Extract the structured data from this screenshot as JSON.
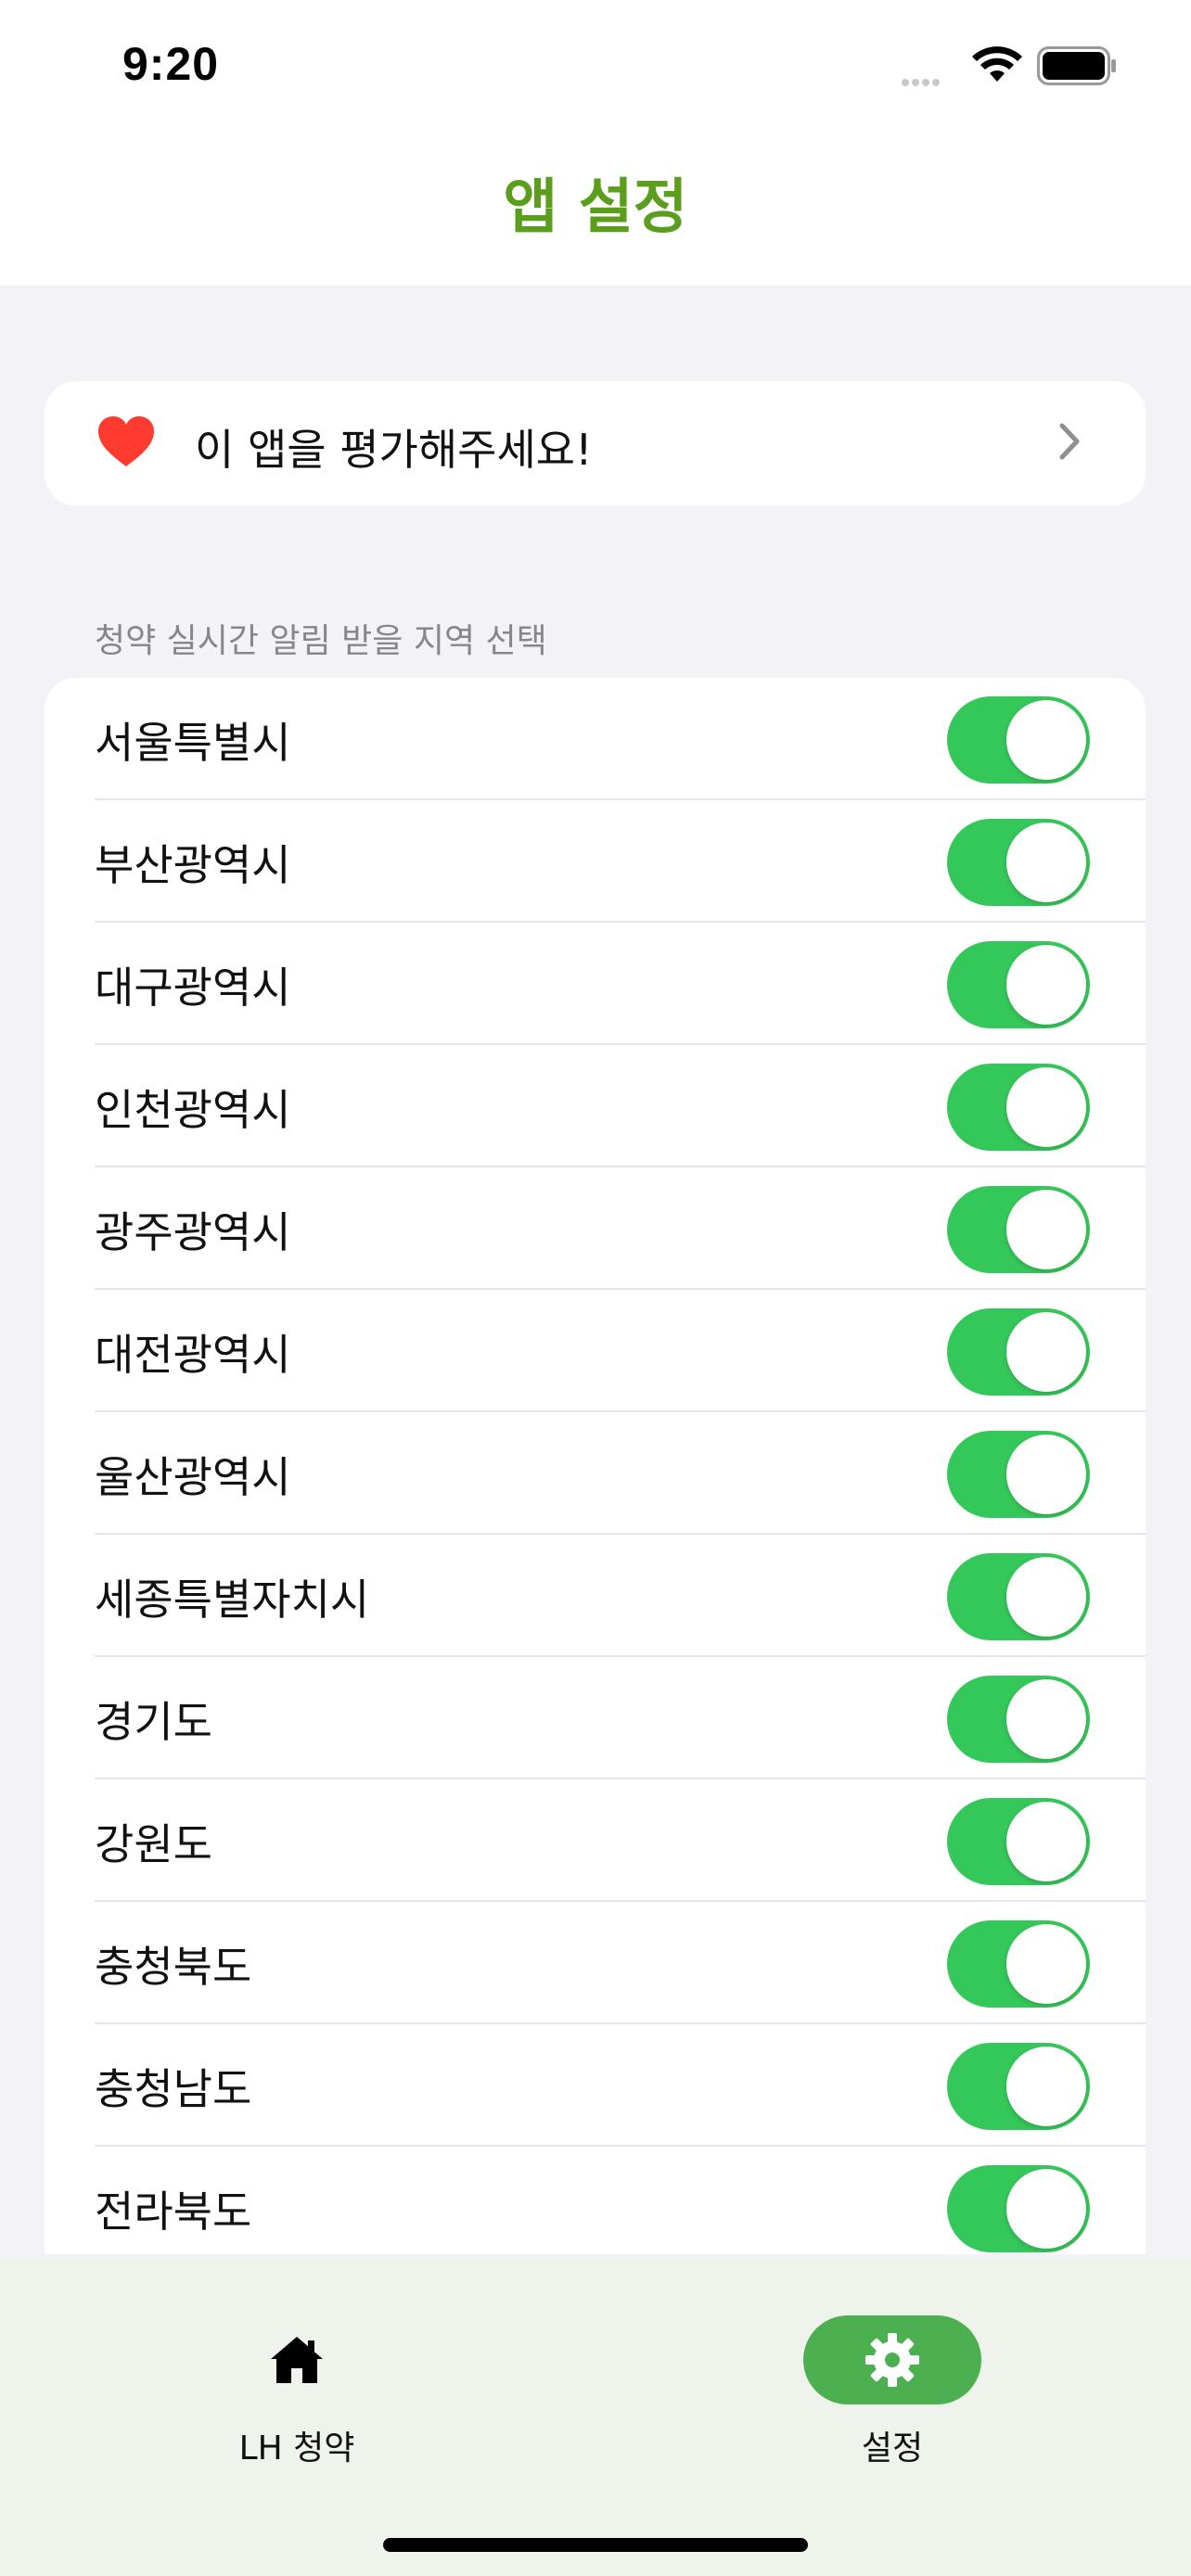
{
  "status_bar": {
    "time": "9:20",
    "signal_icon": "cellular-signal-icon",
    "wifi_icon": "wifi-icon",
    "battery_icon": "battery-full-icon"
  },
  "nav": {
    "title": "앱 설정"
  },
  "rate_app": {
    "icon": "heart-icon",
    "label": "이 앱을 평가해주세요!",
    "chevron_icon": "chevron-right-icon",
    "heart_color": "#ff3b30"
  },
  "regions_section": {
    "header": "청약 실시간 알림 받을 지역 선택",
    "toggle_color": "#34c759",
    "items": [
      {
        "name": "서울특별시",
        "enabled": true
      },
      {
        "name": "부산광역시",
        "enabled": true
      },
      {
        "name": "대구광역시",
        "enabled": true
      },
      {
        "name": "인천광역시",
        "enabled": true
      },
      {
        "name": "광주광역시",
        "enabled": true
      },
      {
        "name": "대전광역시",
        "enabled": true
      },
      {
        "name": "울산광역시",
        "enabled": true
      },
      {
        "name": "세종특별자치시",
        "enabled": true
      },
      {
        "name": "경기도",
        "enabled": true
      },
      {
        "name": "강원도",
        "enabled": true
      },
      {
        "name": "충청북도",
        "enabled": true
      },
      {
        "name": "충청남도",
        "enabled": true
      },
      {
        "name": "전라북도",
        "enabled": true
      }
    ]
  },
  "tab_bar": {
    "tabs": [
      {
        "label": "LH 청약",
        "icon": "home-icon",
        "active": false
      },
      {
        "label": "설정",
        "icon": "gear-icon",
        "active": true
      }
    ],
    "accent": "#4caf50"
  },
  "title_color": "#5a9e1b"
}
